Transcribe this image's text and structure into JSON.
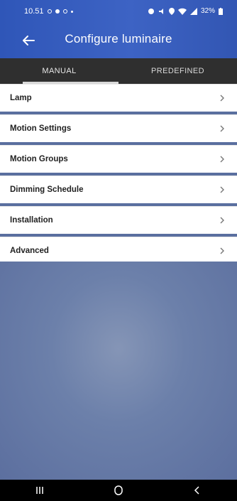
{
  "status": {
    "time": "10.51",
    "battery": "32%"
  },
  "app_bar": {
    "title": "Configure luminaire"
  },
  "tabs": [
    {
      "label": "MANUAL",
      "active": true
    },
    {
      "label": "PREDEFINED",
      "active": false
    }
  ],
  "menu": {
    "items": [
      {
        "label": "Lamp"
      },
      {
        "label": "Motion Settings"
      },
      {
        "label": "Motion Groups"
      },
      {
        "label": "Dimming Schedule"
      },
      {
        "label": "Installation"
      },
      {
        "label": "Advanced"
      }
    ]
  },
  "colors": {
    "app_bar_blue": "#3d63c4",
    "tab_bar_dark": "#2f2f2f",
    "nav_black": "#000000"
  },
  "icons": {
    "back": "arrow-left-icon",
    "chevron": "chevron-right-icon",
    "nav_recents": "recents-icon",
    "nav_home": "home-icon",
    "nav_back": "nav-back-icon"
  }
}
